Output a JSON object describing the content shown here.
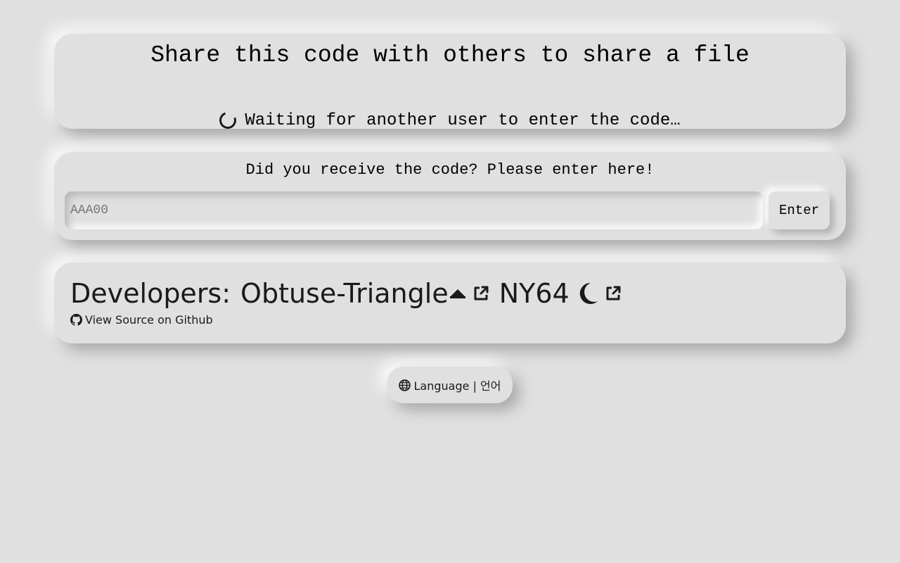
{
  "share": {
    "title": "Share this code with others to share a file",
    "waiting": "Waiting for another user to enter the code…"
  },
  "code_entry": {
    "prompt": "Did you receive the code? Please enter here!",
    "placeholder": "AAA00",
    "value": "",
    "enter_label": "Enter"
  },
  "developers": {
    "label": "Developers:",
    "dev1": "Obtuse-Triangle",
    "dev2": "NY64",
    "source_label": "View Source on Github"
  },
  "language": {
    "label": "Language | 언어"
  },
  "icons": {
    "spinner": "spinner-icon",
    "triangle": "triangle-up-icon",
    "external_link": "external-link-icon",
    "moon": "moon-icon",
    "github": "github-icon",
    "globe": "globe-icon"
  }
}
